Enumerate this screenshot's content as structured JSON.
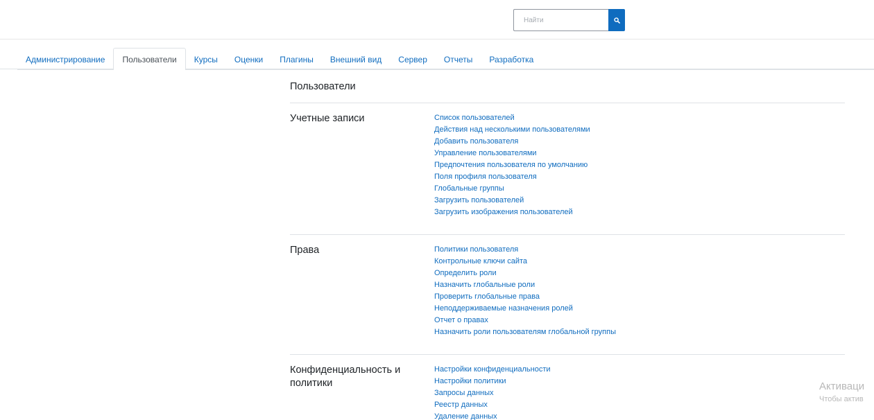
{
  "search": {
    "placeholder": "Найти",
    "button_icon": "search-icon",
    "accent": "#0f6cbf"
  },
  "tabs": [
    {
      "label": "Администрирование",
      "active": false
    },
    {
      "label": "Пользователи",
      "active": true
    },
    {
      "label": "Курсы",
      "active": false
    },
    {
      "label": "Оценки",
      "active": false
    },
    {
      "label": "Плагины",
      "active": false
    },
    {
      "label": "Внешний вид",
      "active": false
    },
    {
      "label": "Сервер",
      "active": false
    },
    {
      "label": "Отчеты",
      "active": false
    },
    {
      "label": "Разработка",
      "active": false
    }
  ],
  "page_title": "Пользователи",
  "sections": [
    {
      "title": "Учетные записи",
      "links": [
        "Список пользователей",
        "Действия над несколькими пользователями",
        "Добавить пользователя",
        "Управление пользователями",
        "Предпочтения пользователя по умолчанию",
        "Поля профиля пользователя",
        "Глобальные группы",
        "Загрузить пользователей",
        "Загрузить изображения пользователей"
      ]
    },
    {
      "title": "Права",
      "links": [
        "Политики пользователя",
        "Контрольные ключи сайта",
        "Определить роли",
        "Назначить глобальные роли",
        "Проверить глобальные права",
        "Неподдерживаемые назначения ролей",
        "Отчет о правах",
        "Назначить роли пользователям глобальной группы"
      ]
    },
    {
      "title": "Конфиденциальность и политики",
      "links": [
        "Настройки конфиденциальности",
        "Настройки политики",
        "Запросы данных",
        "Реестр данных",
        "Удаление данных"
      ]
    }
  ],
  "watermark": {
    "line1": "Активаци",
    "line2": "Чтобы актив"
  }
}
